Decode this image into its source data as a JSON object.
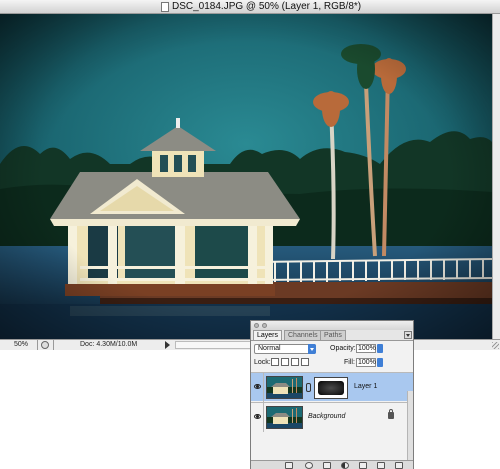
{
  "document": {
    "title": "DSC_0184.JPG @ 50% (Layer 1, RGB/8*)",
    "zoom": "50%",
    "doc_size": "Doc: 4.30M/10.0M"
  },
  "layers_panel": {
    "tabs": [
      {
        "label": "Layers",
        "active": true
      },
      {
        "label": "Channels",
        "active": false
      },
      {
        "label": "Paths",
        "active": false
      }
    ],
    "blend_mode": "Normal",
    "opacity_label": "Opacity:",
    "opacity_value": "100%",
    "lock_label": "Lock:",
    "fill_label": "Fill:",
    "fill_value": "100%",
    "layers": [
      {
        "name": "Layer 1",
        "visible": true,
        "selected": true,
        "has_mask": true
      },
      {
        "name": "Background",
        "visible": true,
        "selected": false,
        "locked": true
      }
    ],
    "bottom_icons": [
      "link-icon",
      "layer-style-icon",
      "add-mask-icon",
      "adjustment-layer-icon",
      "new-group-icon",
      "new-layer-icon",
      "trash-icon"
    ]
  },
  "colors": {
    "selection": "#a9c8ef",
    "sky": "#1e6f78",
    "water": "#1d4a6a"
  }
}
